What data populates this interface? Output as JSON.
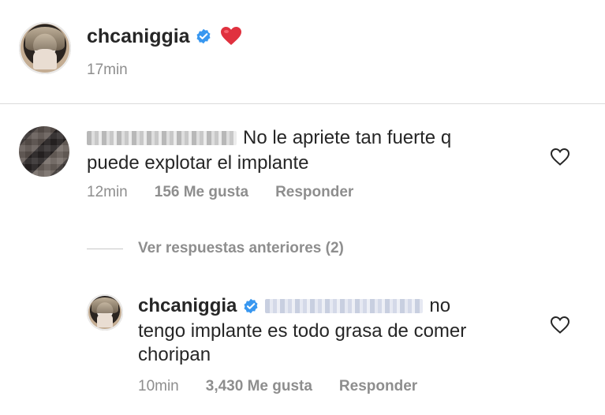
{
  "post": {
    "username": "chcaniggia",
    "verified": true,
    "emoji": "❤️",
    "time": "17min"
  },
  "comment": {
    "text_line1": "No le apriete tan fuerte q",
    "text_line2": "puede explotar el implante",
    "time": "12min",
    "likes": "156 Me gusta",
    "reply_label": "Responder"
  },
  "view_replies": "Ver respuestas anteriores (2)",
  "reply": {
    "username": "chcaniggia",
    "verified": true,
    "text_line1_end": "no",
    "text_line2": "tengo implante es todo grasa de comer",
    "text_line3": "choripan",
    "time": "10min",
    "likes": "3,430 Me gusta",
    "reply_label": "Responder"
  },
  "colors": {
    "text": "#262626",
    "muted": "#8e8e8e",
    "verified_blue": "#3897f0",
    "heart_red": "#ed4956",
    "divider": "#dbdbdb"
  },
  "icons": [
    "verified-badge-icon",
    "heart-emoji-icon",
    "heart-outline-icon"
  ]
}
